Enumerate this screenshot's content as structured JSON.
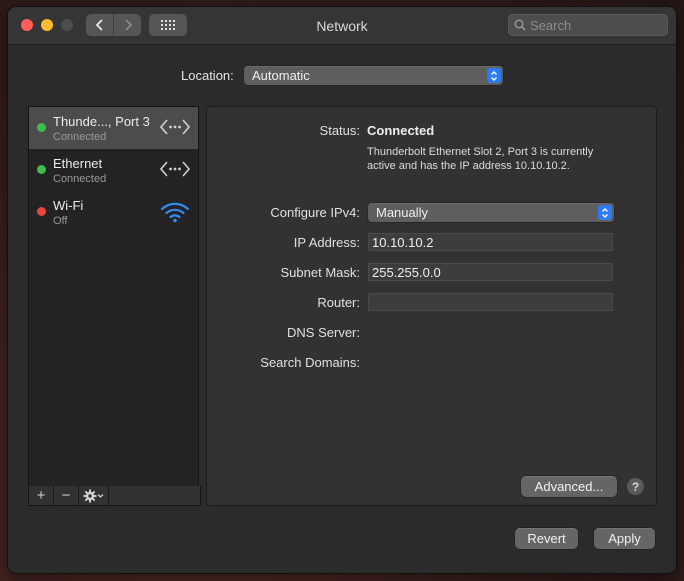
{
  "window": {
    "title": "Network"
  },
  "search": {
    "placeholder": "Search"
  },
  "location": {
    "label": "Location:",
    "value": "Automatic"
  },
  "services": [
    {
      "name": "Thunde..., Port 3",
      "state": "Connected",
      "status_color": "#3dbd4a",
      "icon": "ethernet-icon",
      "selected": true
    },
    {
      "name": "Ethernet",
      "state": "Connected",
      "status_color": "#3dbd4a",
      "icon": "ethernet-icon",
      "selected": false
    },
    {
      "name": "Wi-Fi",
      "state": "Off",
      "status_color": "#e5463c",
      "icon": "wifi-icon",
      "selected": false
    }
  ],
  "sidebar_tools": {
    "add": "+",
    "remove": "−"
  },
  "detail": {
    "status_label": "Status:",
    "status_value": "Connected",
    "status_desc_line1": "Thunderbolt Ethernet Slot 2, Port 3 is currently",
    "status_desc_line2": "active and has the IP address 10.10.10.2.",
    "configure_label": "Configure IPv4:",
    "configure_value": "Manually",
    "ip_label": "IP Address:",
    "ip_value": "10.10.10.2",
    "subnet_label": "Subnet Mask:",
    "subnet_value": "255.255.0.0",
    "router_label": "Router:",
    "router_value": "",
    "dns_label": "DNS Server:",
    "search_domains_label": "Search Domains:",
    "advanced_label": "Advanced...",
    "help_label": "?"
  },
  "footer": {
    "revert_label": "Revert",
    "apply_label": "Apply"
  },
  "colors": {
    "accent": "#2d7bf5",
    "wifi_blue": "#2f8ff5"
  }
}
